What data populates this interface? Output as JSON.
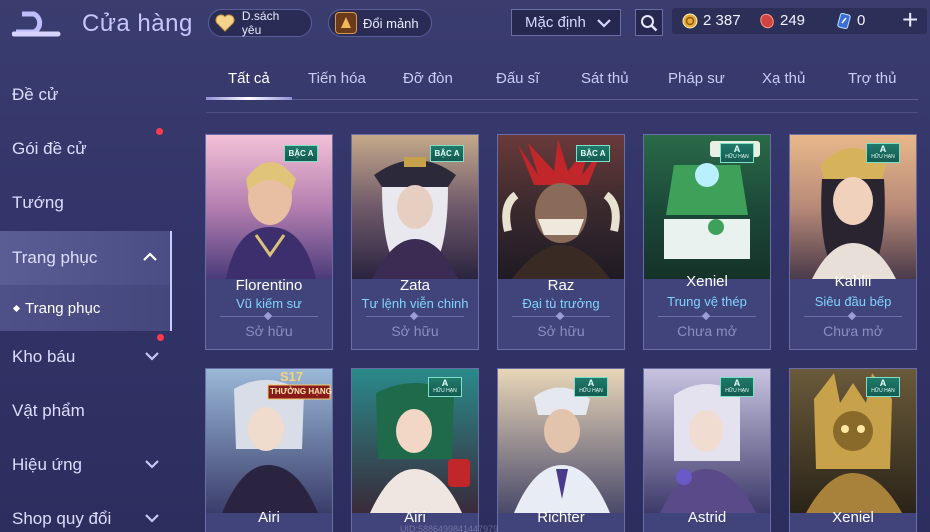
{
  "header": {
    "title": "Cửa hàng",
    "favorites_label": "D.sách yêu",
    "exchange_label": "Đổi mảnh",
    "sort_label": "Mặc định",
    "currencies": [
      {
        "name": "gold",
        "value": "2 387"
      },
      {
        "name": "ruby",
        "value": "249"
      },
      {
        "name": "voucher",
        "value": "0"
      }
    ],
    "plus_label": "+"
  },
  "sidebar": {
    "items": [
      {
        "label": "Đề cử"
      },
      {
        "label": "Gói đề cử"
      },
      {
        "label": "Tướng"
      },
      {
        "label": "Trang phục"
      },
      {
        "label": "Kho báu"
      },
      {
        "label": "Vật phẩm"
      },
      {
        "label": "Hiệu ứng"
      },
      {
        "label": "Shop quy đổi"
      }
    ],
    "sub_item": "Trang phục"
  },
  "tabs": [
    {
      "label": "Tất cả"
    },
    {
      "label": "Tiến hóa"
    },
    {
      "label": "Đỡ đòn"
    },
    {
      "label": "Đấu sĩ"
    },
    {
      "label": "Sát thủ"
    },
    {
      "label": "Pháp sư"
    },
    {
      "label": "Xạ thủ"
    },
    {
      "label": "Trợ thủ"
    }
  ],
  "skins_row1": [
    {
      "hero": "Florentino",
      "skin": "Vũ kiếm sư",
      "status": "Sở hữu",
      "badge": "BẬC A"
    },
    {
      "hero": "Zata",
      "skin": "Tư lệnh viễn chinh",
      "status": "Sở hữu",
      "badge": "BẬC A"
    },
    {
      "hero": "Raz",
      "skin": "Đại tù trưởng",
      "status": "Sở hữu",
      "badge": "BẬC A"
    },
    {
      "hero": "Xeniel",
      "skin": "Trung vệ thép",
      "status": "Chưa mở",
      "badge_big": "A",
      "badge_small": "HỮU HẠN"
    },
    {
      "hero": "Kahlii",
      "skin": "Siêu đầu bếp",
      "status": "Chưa mở",
      "badge_big": "A",
      "badge_small": "HỮU HẠN"
    }
  ],
  "skins_row2": [
    {
      "hero": "Airi",
      "s17_top": "S17",
      "s17_bottom": "THƯỞNG HẠNG"
    },
    {
      "hero": "Airi",
      "badge_big": "A",
      "badge_small": "HỮU HẠN"
    },
    {
      "hero": "Richter",
      "badge_big": "A",
      "badge_small": "HỮU HẠN"
    },
    {
      "hero": "Astrid",
      "badge_big": "A",
      "badge_small": "HỮU HẠN"
    },
    {
      "hero": "Xeniel",
      "badge_big": "A",
      "badge_small": "HỮU HẠN"
    }
  ],
  "watermark": "UID:5886499841447979"
}
